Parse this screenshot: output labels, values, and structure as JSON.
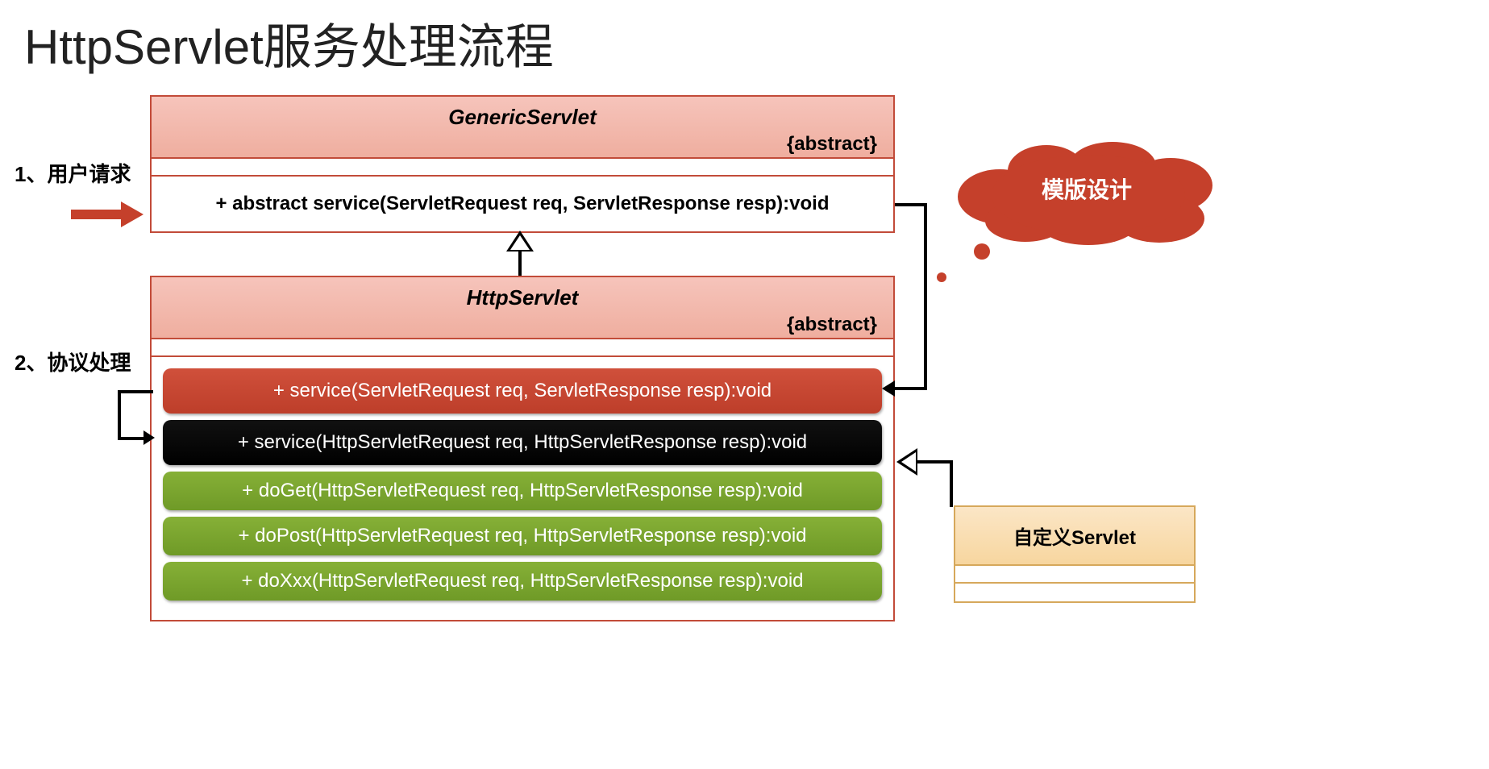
{
  "title": "HttpServlet服务处理流程",
  "steps": {
    "s1": "1、用户请求",
    "s2": "2、协议处理"
  },
  "generic": {
    "name": "GenericServlet",
    "stereo": "{abstract}",
    "method": "+ abstract service(ServletRequest req, ServletResponse resp):void"
  },
  "http": {
    "name": "HttpServlet",
    "stereo": "{abstract}",
    "methods": {
      "m1": "+ service(ServletRequest req, ServletResponse resp):void",
      "m2": "+ service(HttpServletRequest req, HttpServletResponse resp):void",
      "m3": "+ doGet(HttpServletRequest req, HttpServletResponse resp):void",
      "m4": "+ doPost(HttpServletRequest req, HttpServletResponse resp):void",
      "m5": "+ doXxx(HttpServletRequest req, HttpServletResponse resp):void"
    }
  },
  "custom": {
    "name": "自定义Servlet"
  },
  "cloud": {
    "label": "模版设计"
  },
  "colors": {
    "accentRed": "#c5402b",
    "pillGreen": "#7aa52d",
    "boxOrange": "#d6a85b"
  }
}
